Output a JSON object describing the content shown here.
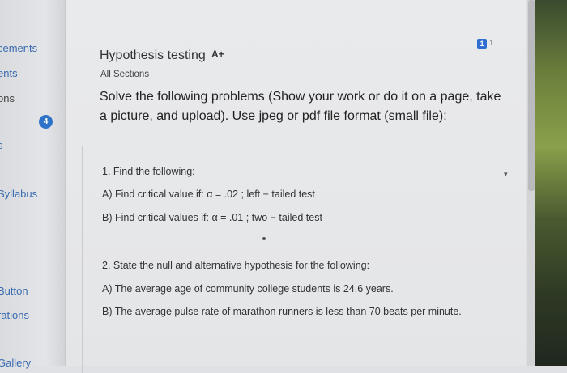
{
  "sidebar": {
    "items": [
      {
        "label": "cements"
      },
      {
        "label": "ents"
      },
      {
        "label": "ons"
      },
      {
        "label": "s"
      },
      {
        "label": "Syllabus"
      },
      {
        "label": "Button"
      },
      {
        "label": "rations"
      },
      {
        "label": "Gallery"
      }
    ],
    "badge": "4"
  },
  "header": {
    "more_label": "⋯",
    "page_badge": "1",
    "page_count": "1"
  },
  "page": {
    "title": "Hypothesis testing",
    "title_icon": "A+",
    "breadcrumb": "All Sections",
    "instructions": "Solve the following problems (Show your work or do it on a page, take a picture, and upload). Use jpeg or pdf file format (small file):"
  },
  "questions": [
    {
      "heading": "1. Find the following:",
      "parts": [
        {
          "text": "A) Find critical value if: α = .02 ; left − tailed test"
        },
        {
          "text": "B) Find critical values if: α = .01 ; two − tailed test"
        }
      ]
    },
    {
      "heading": "2. State the null and alternative hypothesis for the following:",
      "parts": [
        {
          "text": "A) The average age of community college students is 24.6 years."
        },
        {
          "text": "B) The average pulse rate of marathon runners is less than 70 beats per minute."
        }
      ]
    }
  ],
  "colors": {
    "accent": "#2f73c8",
    "link": "#3a6bb0"
  }
}
